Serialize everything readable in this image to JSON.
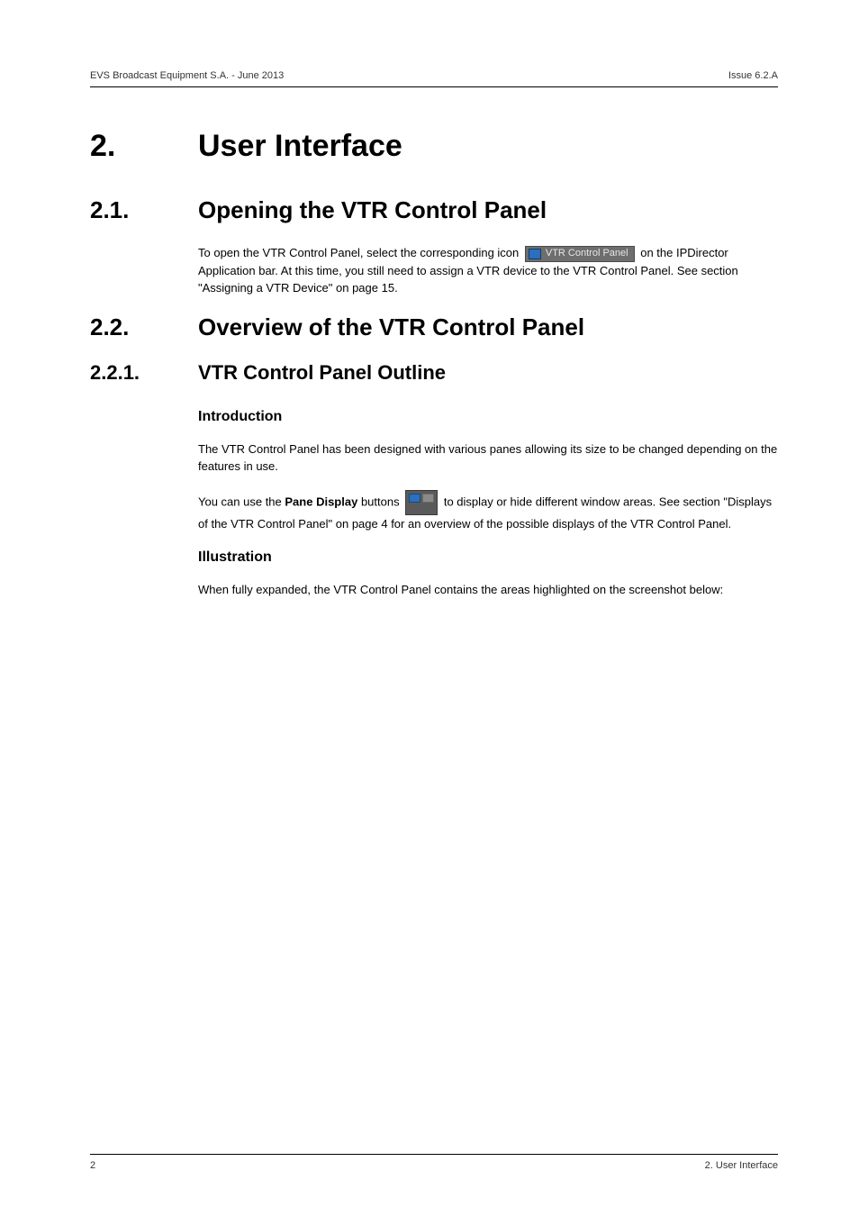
{
  "header": {
    "left": "EVS Broadcast Equipment S.A. - June 2013",
    "right": "Issue 6.2.A"
  },
  "s2": {
    "num": "2.",
    "title": "User Interface"
  },
  "s21": {
    "num": "2.1.",
    "title": "Opening the VTR Control Panel"
  },
  "s22": {
    "num": "2.2.",
    "title": "Overview of the VTR Control Panel"
  },
  "s221": {
    "num": "2.2.1.",
    "title": "VTR Control Panel Outline"
  },
  "p21": {
    "a": "To open the VTR Control Panel, select the corresponding icon ",
    "chip": "VTR Control Panel",
    "b": " on the IPDirector Application bar. At this time, you still need to assign a VTR device to the VTR Control Panel. See section \"Assigning a VTR Device\" on page 15."
  },
  "intro": {
    "h": "Introduction",
    "p1": "The VTR Control Panel has been designed with various panes allowing its size to be changed depending on the features in use.",
    "p2a": "You can use the ",
    "p2bold": "Pane Display",
    "p2b": " buttons ",
    "p2c": " to display or hide different window areas. See section \"Displays of the VTR Control Panel\" on page 4 for an overview of the possible displays of the VTR Control Panel."
  },
  "illus": {
    "h": "Illustration",
    "p": "When fully expanded, the VTR Control Panel contains the areas highlighted on the screenshot below:"
  },
  "footer": {
    "left": "2",
    "right": "2. User Interface"
  }
}
